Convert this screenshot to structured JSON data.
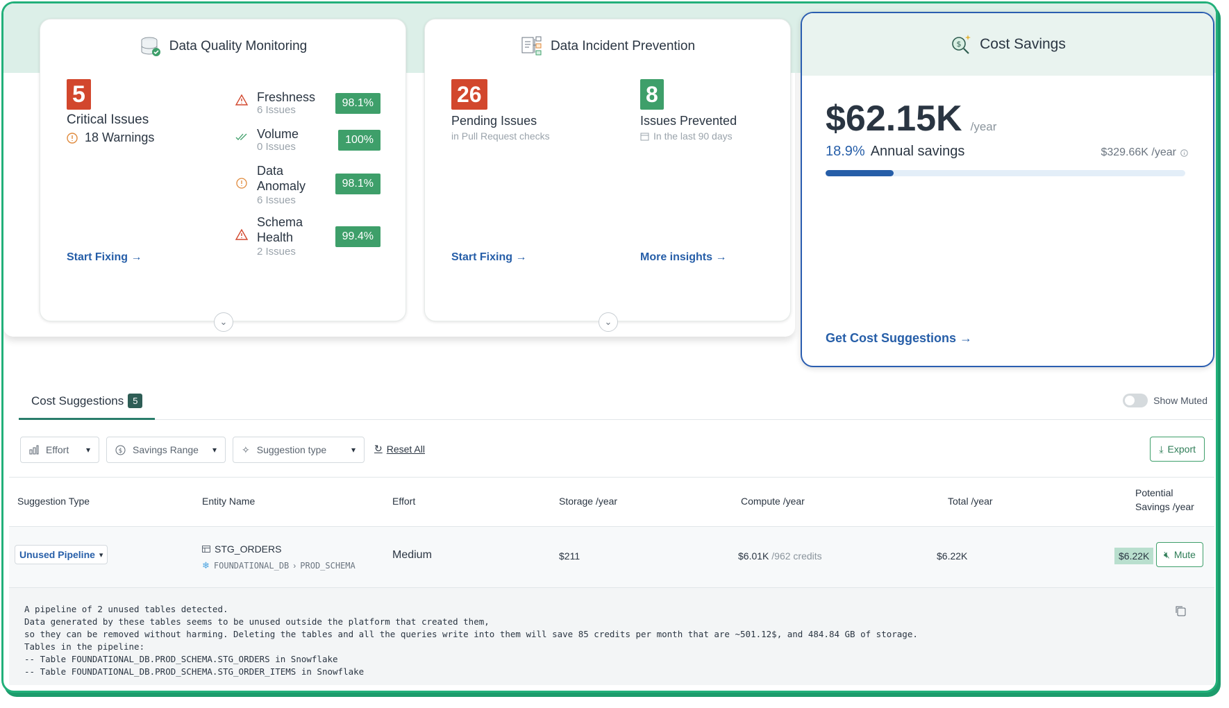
{
  "cards": {
    "quality": {
      "title": "Data Quality Monitoring",
      "critical_count": "5",
      "critical_label": "Critical Issues",
      "warnings": "18 Warnings",
      "metrics": [
        {
          "name_line1": "Freshness",
          "name_line2": "",
          "issues": "6 Issues",
          "pct": "98.1%"
        },
        {
          "name_line1": "Volume",
          "name_line2": "",
          "issues": "0 Issues",
          "pct": "100%"
        },
        {
          "name_line1": "Data",
          "name_line2": "Anomaly",
          "issues": "6 Issues",
          "pct": "98.1%"
        },
        {
          "name_line1": "Schema",
          "name_line2": "Health",
          "issues": "2 Issues",
          "pct": "99.4%"
        }
      ],
      "link": "Start Fixing →"
    },
    "incident": {
      "title": "Data Incident Prevention",
      "pending_count": "26",
      "pending_label": "Pending Issues",
      "pending_sub": "in Pull Request checks",
      "prevented_count": "8",
      "prevented_label": "Issues Prevented",
      "prevented_sub": "In the last 90 days",
      "link_left": "Start Fixing →",
      "link_right": "More insights →"
    },
    "cost": {
      "title": "Cost Savings",
      "amount": "$62.15K",
      "per": "/year",
      "pct": "18.9%",
      "pct_label": "Annual savings",
      "total": "$329.66K /year",
      "progress": 0.189,
      "link": "Get Cost Suggestions →"
    }
  },
  "tabs": {
    "active_label": "Cost Suggestions",
    "active_count": "5",
    "toggle_label": "Show Muted"
  },
  "filters": {
    "effort": "Effort",
    "savings_range": "Savings Range",
    "suggestion_type": "Suggestion type",
    "reset": "Reset All",
    "export": "Export"
  },
  "table": {
    "headers": {
      "suggestion_type": "Suggestion Type",
      "entity_name": "Entity Name",
      "effort": "Effort",
      "storage": "Storage /year",
      "compute": "Compute /year",
      "total": "Total /year",
      "potential_1": "Potential",
      "potential_2": "Savings /year"
    },
    "row": {
      "type": "Unused Pipeline",
      "entity": "STG_ORDERS",
      "db": "FOUNDATIONAL_DB",
      "schema": "PROD_SCHEMA",
      "effort": "Medium",
      "storage": "$211",
      "compute": "$6.01K",
      "credits": "/962 credits",
      "total": "$6.22K",
      "savings": "$6.22K",
      "mute": "Mute"
    },
    "description": "A pipeline of 2 unused tables detected.\nData generated by these tables seems to be unused outside the platform that created them,\nso they can be removed without harming. Deleting the tables and all the queries write into them will save 85 credits per month that are ~501.12$, and 484.84 GB of storage.\nTables in the pipeline:\n-- Table FOUNDATIONAL_DB.PROD_SCHEMA.STG_ORDERS in Snowflake\n-- Table FOUNDATIONAL_DB.PROD_SCHEMA.STG_ORDER_ITEMS in Snowflake"
  },
  "colors": {
    "red": "#d2472d",
    "green": "#3e9f6a",
    "blue": "#265ea8",
    "frame": "#22b07a"
  }
}
